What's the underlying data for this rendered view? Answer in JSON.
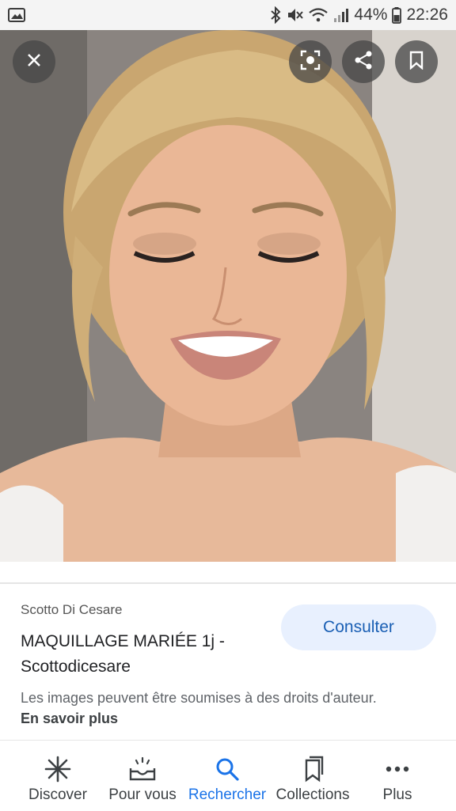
{
  "status_bar": {
    "battery": "44%",
    "time": "22:26"
  },
  "result": {
    "source": "Scotto Di Cesare",
    "title": "MAQUILLAGE MARIÉE 1j - Scottodicesare",
    "consult_label": "Consulter",
    "rights_text": "Les images peuvent être soumises à des droits d'auteur.",
    "learn_more": "En savoir plus"
  },
  "bottom_nav": {
    "items": [
      {
        "label": "Discover",
        "icon": "asterisk-icon"
      },
      {
        "label": "Pour vous",
        "icon": "inbox-icon"
      },
      {
        "label": "Rechercher",
        "icon": "search-icon",
        "active": true
      },
      {
        "label": "Collections",
        "icon": "bookmark-icon"
      },
      {
        "label": "Plus",
        "icon": "more-icon"
      }
    ]
  },
  "colors": {
    "accent": "#1a73e8",
    "button_bg": "#e8f0fe"
  }
}
